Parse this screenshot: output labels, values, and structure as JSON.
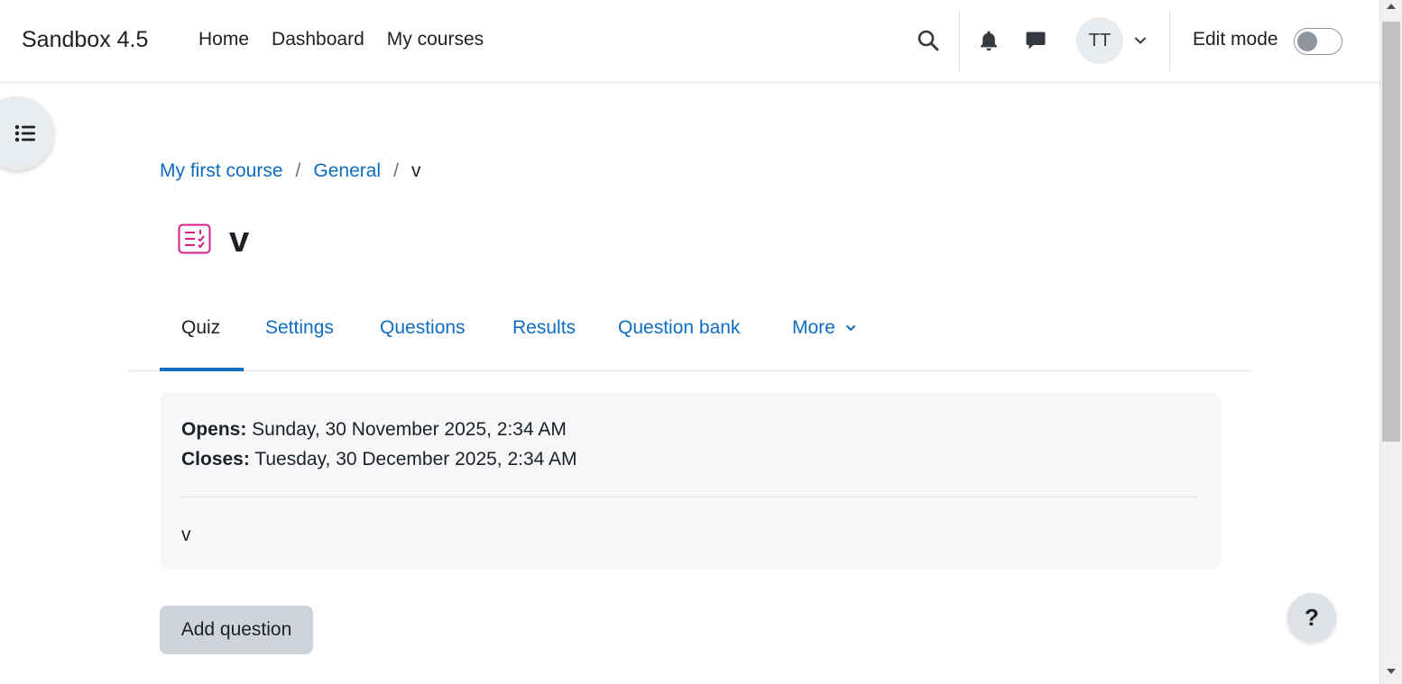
{
  "navbar": {
    "brand": "Sandbox 4.5",
    "links": [
      "Home",
      "Dashboard",
      "My courses"
    ],
    "avatar_initials": "TT",
    "edit_mode_label": "Edit mode",
    "edit_mode_on": false
  },
  "breadcrumb": {
    "items": [
      "My first course",
      "General"
    ],
    "current": "v",
    "separator": "/"
  },
  "page": {
    "title": "v",
    "icon": "quiz-icon",
    "icon_color": "#d51e8a"
  },
  "tabs": {
    "items": [
      "Quiz",
      "Settings",
      "Questions",
      "Results",
      "Question bank",
      "More"
    ],
    "active": "Quiz"
  },
  "info": {
    "opens_label": "Opens:",
    "opens_value": " Sunday, 30 November 2025, 2:34 AM",
    "closes_label": "Closes:",
    "closes_value": " Tuesday, 30 December 2025, 2:34 AM",
    "description": "v"
  },
  "actions": {
    "add_question": "Add question"
  },
  "help": {
    "label": "?"
  },
  "colors": {
    "link": "#0f6cbf",
    "text": "#1d2125",
    "card_bg": "#f5f7f8"
  }
}
